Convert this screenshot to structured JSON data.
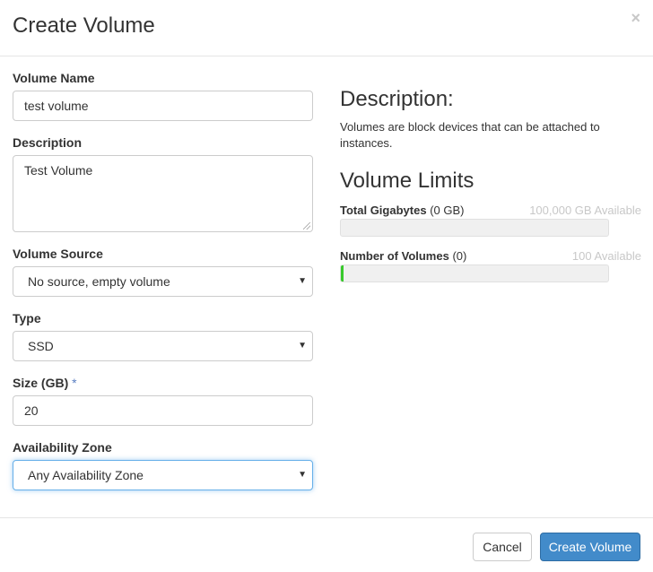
{
  "dialog": {
    "title": "Create Volume",
    "close_symbol": "×"
  },
  "form": {
    "volume_name": {
      "label": "Volume Name",
      "value": "test volume"
    },
    "description": {
      "label": "Description",
      "value": "Test Volume"
    },
    "volume_source": {
      "label": "Volume Source",
      "value": "No source, empty volume"
    },
    "type": {
      "label": "Type",
      "value": "SSD"
    },
    "size": {
      "label": "Size (GB)",
      "required_mark": "*",
      "value": "20"
    },
    "availability_zone": {
      "label": "Availability Zone",
      "value": "Any Availability Zone"
    }
  },
  "info": {
    "heading": "Description:",
    "text": "Volumes are block devices that can be attached to instances.",
    "limits_heading": "Volume Limits",
    "total_gigabytes": {
      "label": "Total Gigabytes",
      "used": "(0 GB)",
      "available": "100,000 GB Available",
      "fill_fraction": 0
    },
    "number_of_volumes": {
      "label": "Number of Volumes",
      "used": "(0)",
      "available": "100 Available",
      "fill_fraction": 0.01
    }
  },
  "footer": {
    "cancel_label": "Cancel",
    "submit_label": "Create Volume"
  },
  "colors": {
    "primary": "#428bca",
    "progress": "#38c92c",
    "required": "#5a7fc2"
  }
}
